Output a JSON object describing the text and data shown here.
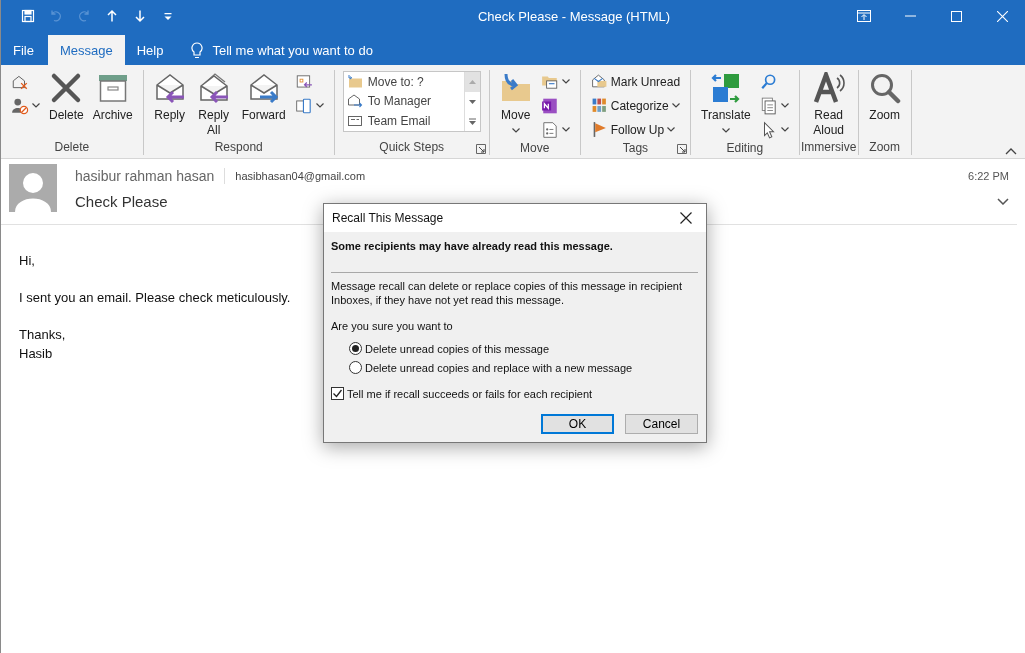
{
  "window": {
    "title": "Check Please  -  Message (HTML)"
  },
  "quick_access": [
    {
      "disabled": false
    },
    {
      "disabled": true
    },
    {
      "disabled": true
    },
    {
      "disabled": false
    },
    {
      "disabled": false
    },
    {
      "disabled": false
    }
  ],
  "ribbon_tabs": [
    {
      "label": "File",
      "selected": false
    },
    {
      "label": "Message",
      "selected": true
    },
    {
      "label": "Help",
      "selected": false
    }
  ],
  "tell_me": {
    "label": "Tell me what you want to do"
  },
  "ribbon_groups": [
    {
      "label": "Delete",
      "launcher": false,
      "columns": [
        [
          {
            "kind": "icon",
            "dropdown": false
          },
          {
            "kind": "icon",
            "dropdown": true
          }
        ],
        [
          {
            "kind": "large",
            "label": "Delete",
            "dropdown": false
          }
        ],
        [
          {
            "kind": "large",
            "label": "Archive",
            "dropdown": false
          }
        ]
      ]
    },
    {
      "label": "Respond",
      "launcher": false,
      "columns": [
        [
          {
            "kind": "large",
            "label": "Reply",
            "dropdown": false
          }
        ],
        [
          {
            "kind": "large",
            "label": "Reply All",
            "dropdown": false
          }
        ],
        [
          {
            "kind": "large",
            "label": "Forward",
            "dropdown": false
          }
        ],
        [
          {
            "kind": "icon",
            "dropdown": false
          },
          {
            "kind": "icon",
            "dropdown": true
          }
        ]
      ]
    },
    {
      "label": "Quick Steps",
      "launcher": true,
      "gallery": [
        {
          "label": "Move to: ?"
        },
        {
          "label": "To Manager"
        },
        {
          "label": "Team Email"
        }
      ]
    },
    {
      "label": "Move",
      "launcher": false,
      "columns": [
        [
          {
            "kind": "large",
            "label": "Move",
            "dropdown": true
          }
        ],
        [
          {
            "kind": "icon",
            "dropdown": true
          },
          {
            "kind": "icon",
            "dropdown": false
          },
          {
            "kind": "icon",
            "dropdown": true
          }
        ]
      ]
    },
    {
      "label": "Tags",
      "launcher": true,
      "columns": [
        [
          {
            "kind": "small",
            "label": "Mark Unread",
            "dropdown": false
          },
          {
            "kind": "small",
            "label": "Categorize",
            "dropdown": true
          },
          {
            "kind": "small",
            "label": "Follow Up",
            "dropdown": true
          }
        ]
      ]
    },
    {
      "label": "Editing",
      "launcher": false,
      "columns": [
        [
          {
            "kind": "large",
            "label": "Translate",
            "dropdown": true
          }
        ],
        [
          {
            "kind": "icon",
            "dropdown": false
          },
          {
            "kind": "icon",
            "dropdown": true
          },
          {
            "kind": "icon",
            "dropdown": true
          }
        ]
      ]
    },
    {
      "label": "Immersive",
      "launcher": false,
      "columns": [
        [
          {
            "kind": "large",
            "label": "Read Aloud",
            "dropdown": false
          }
        ]
      ]
    },
    {
      "label": "Zoom",
      "launcher": false,
      "columns": [
        [
          {
            "kind": "large",
            "label": "Zoom",
            "dropdown": false
          }
        ]
      ]
    }
  ],
  "message": {
    "sender": "hasibur rahman hasan",
    "email": "hasibhasan04@gmail.com",
    "time": "6:22 PM",
    "subject": "Check Please",
    "body": [
      [
        "Hi,"
      ],
      [
        "I sent you an email. Please check meticulously."
      ],
      [
        "Thanks,",
        "Hasib"
      ]
    ]
  },
  "dialog": {
    "title": "Recall This Message",
    "warning": "Some recipients may have already read this message.",
    "description": "Message recall can delete or replace copies of this message in recipient Inboxes, if they have not yet read this message.",
    "question": "Are you sure you want to",
    "options": [
      {
        "label": "Delete unread copies of this message",
        "selected": true
      },
      {
        "label": "Delete unread copies and replace with a new message",
        "selected": false
      }
    ],
    "checkbox": {
      "label": "Tell me if recall succeeds or fails for each recipient",
      "checked": true
    },
    "buttons": [
      {
        "label": "OK",
        "default": true
      },
      {
        "label": "Cancel",
        "default": false
      }
    ]
  }
}
